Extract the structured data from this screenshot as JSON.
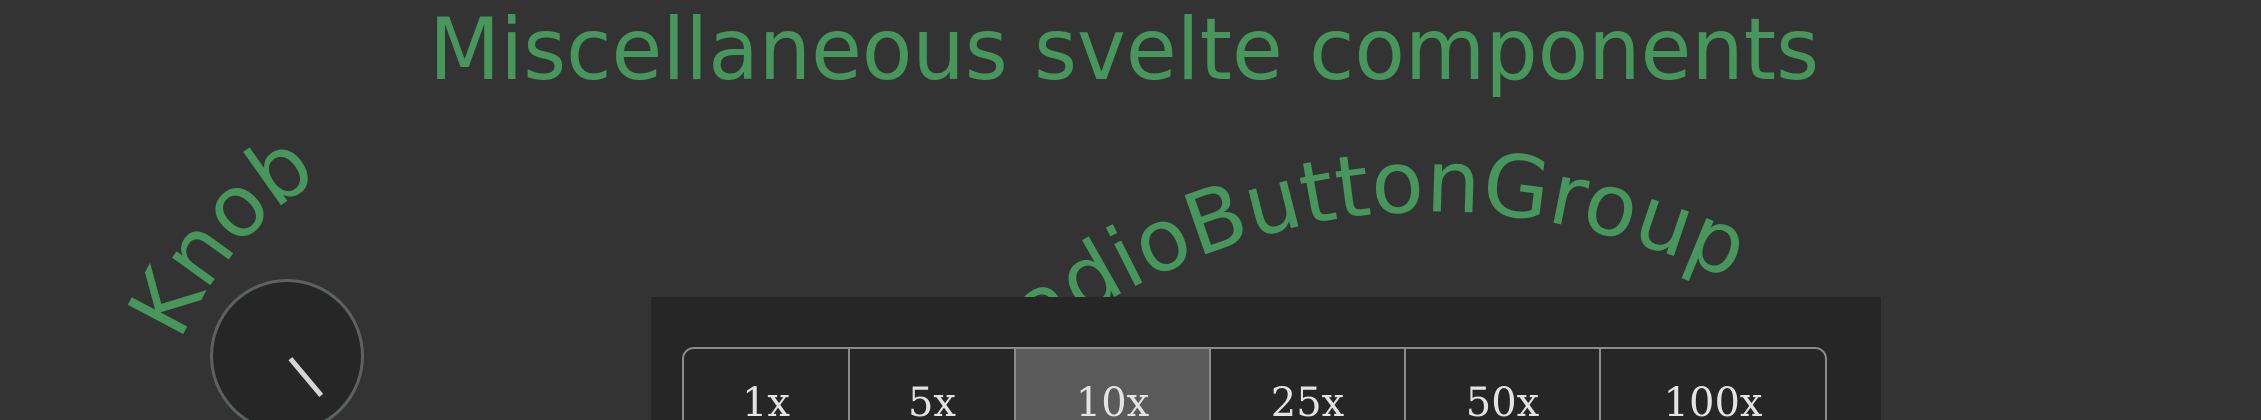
{
  "page": {
    "title": "Miscellaneous svelte components"
  },
  "knob": {
    "label": "Knob"
  },
  "radio_group": {
    "label": "RadioButtonGroup",
    "options": [
      "1x",
      "5x",
      "10x",
      "25x",
      "50x",
      "100x"
    ],
    "selected": "10x"
  },
  "colors": {
    "background": "#333333",
    "accent": "#47965b",
    "panel": "#262626",
    "selected_option": "#5a5a5a",
    "border": "#8b8b8b",
    "text": "#e3e3e3"
  }
}
